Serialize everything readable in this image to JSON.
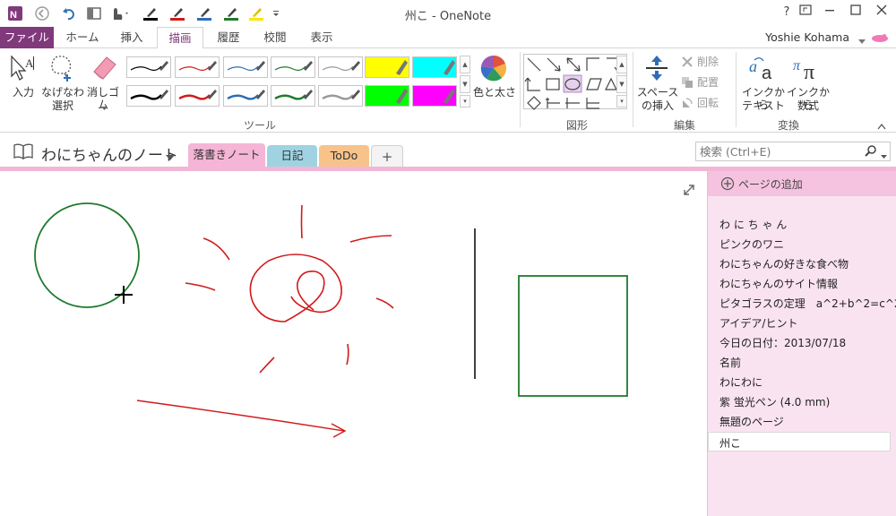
{
  "window": {
    "title": "州こ - OneNote",
    "help": "?",
    "user": "Yoshie Kohama"
  },
  "ribbon_tabs": [
    "ファイル",
    "ホーム",
    "挿入",
    "描画",
    "履歴",
    "校閲",
    "表示"
  ],
  "ribbon": {
    "input_label": "入力",
    "lasso_label_1": "なげなわ",
    "lasso_label_2": "選択",
    "eraser_label": "消しゴム",
    "color_label": "色と太さ",
    "tools_group": "ツール",
    "shapes_group": "図形",
    "space_label_1": "スペース",
    "space_label_2": "の挿入",
    "delete_label": "削除",
    "arrange_label": "配置",
    "rotate_label": "回転",
    "edit_group": "編集",
    "ink_text_1": "インクから",
    "ink_text_2": "テキスト",
    "ink_math_1": "インクから",
    "ink_math_2": "数式",
    "convert_group": "変換",
    "pen_colors": [
      "#000000",
      "#d11a1a",
      "#2d6db5",
      "#1f7a2c",
      "#888888",
      "#ffff00",
      "#00ffff",
      "#000000",
      "#d11a1a",
      "#2d6db5",
      "#1f7a2c",
      "#888888",
      "#00ff00",
      "#ff00ff"
    ]
  },
  "notebook": {
    "title": "わにちゃんのノート",
    "sections": [
      {
        "label": "落書きノート",
        "color": "#f5b5d6"
      },
      {
        "label": "日記",
        "color": "#9fd3e2"
      },
      {
        "label": "ToDo",
        "color": "#f7c38b"
      },
      {
        "label": "+",
        "color": "#f3f3f3"
      }
    ]
  },
  "search": {
    "placeholder": "検索 (Ctrl+E)"
  },
  "pages": {
    "add_label": "ページの追加",
    "items": [
      "わ に ち ゃ ん",
      "ピンクのワニ",
      "わにちゃんの好きな食べ物",
      "わにちゃんのサイト情報",
      "ピタゴラスの定理　a^2+b^2=c^2",
      "アイデア/ヒント",
      "今日の日付：2013/07/18",
      "名前",
      "わにわに",
      "紫 蛍光ペン (4.0 mm)",
      "無題のページ"
    ],
    "current": "州こ"
  },
  "colors": {
    "accent": "#80397b",
    "section_pink": "#f5b5d6",
    "ink_green": "#1f7a2c",
    "ink_red": "#d11a1a"
  }
}
